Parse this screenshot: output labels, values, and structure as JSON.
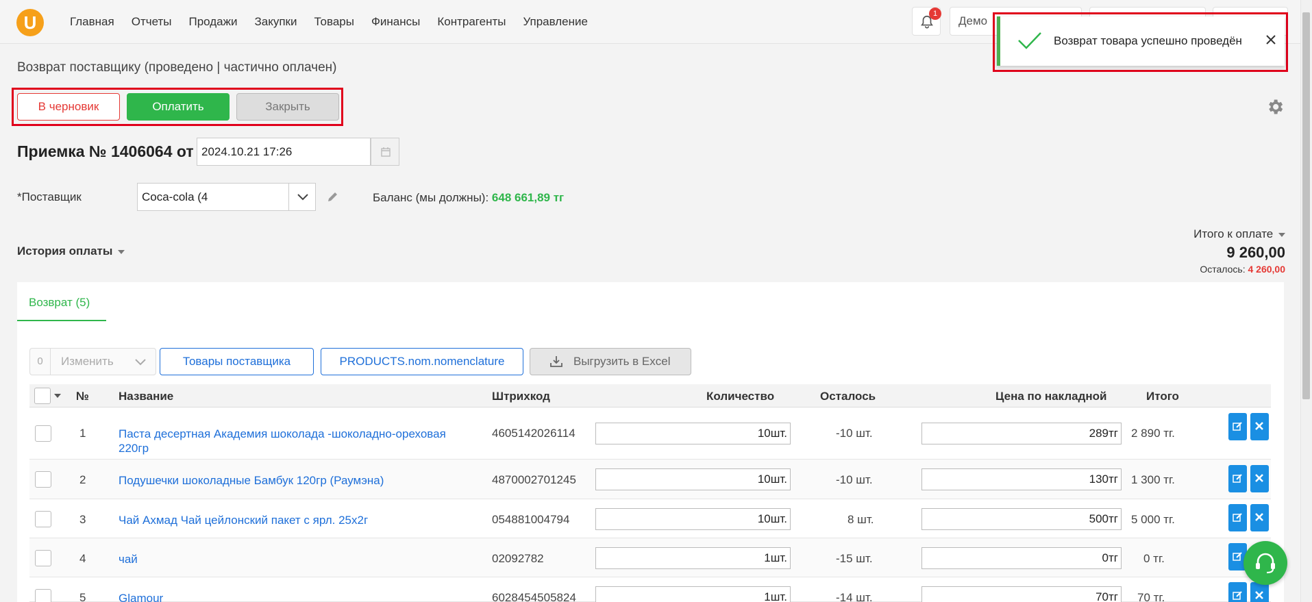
{
  "brand": {
    "logo_letter": "U",
    "accent": "#f6a01a"
  },
  "nav": [
    "Главная",
    "Отчеты",
    "Продажи",
    "Закупки",
    "Товары",
    "Финансы",
    "Контрагенты",
    "Управление"
  ],
  "notifications": {
    "count": "1"
  },
  "org_label": "Демо",
  "toast": {
    "message": "Возврат товара успешно проведён",
    "icon": "check-icon",
    "close_icon": "close-icon"
  },
  "page": {
    "title": "Возврат поставщику (проведено | частично оплачен)"
  },
  "actions": {
    "draft": "В черновик",
    "pay": "Оплатить",
    "close": "Закрыть"
  },
  "receipt": {
    "title": "Приемка № 1406064 от",
    "date": "2024.10.21 17:26"
  },
  "supplier": {
    "label": "*Поставщик",
    "value": "Coca-cola (4",
    "balance_label": "Баланс (мы должны):",
    "balance_value": "648 661,89 тг"
  },
  "payment_history": "История оплаты",
  "totals": {
    "label": "Итого к оплате",
    "value": "9 260,00",
    "remaining_label": "Осталось:",
    "remaining_value": "4 260,00"
  },
  "tab": {
    "label": "Возврат (5)"
  },
  "toolbar": {
    "count": "0",
    "change": "Изменить",
    "supplier_products": "Товары поставщика",
    "nomenclature": "PRODUCTS.nom.nomenclature",
    "excel": "Выгрузить в Excel"
  },
  "table": {
    "columns": {
      "num": "№",
      "name": "Название",
      "barcode": "Штрихкод",
      "qty": "Количество",
      "left": "Осталось",
      "price": "Цена по накладной",
      "total": "Итого"
    },
    "rows": [
      {
        "num": "1",
        "name": "Паста десертная Академия шоколада -шоколадно-ореховая 220гр",
        "barcode": "4605142026114",
        "qty": "10шт.",
        "left": "-10 шт.",
        "price": "289тг",
        "total": "2 890 тг."
      },
      {
        "num": "2",
        "name": "Подушечки шоколадные Бамбук 120гр (Раумэна)",
        "barcode": "4870002701245",
        "qty": "10шт.",
        "left": "-10 шт.",
        "price": "130тг",
        "total": "1 300 тг."
      },
      {
        "num": "3",
        "name": "Чай Ахмад Чай цейлонский пакет с ярл. 25х2г",
        "barcode": "054881004794",
        "qty": "10шт.",
        "left": "8 шт.",
        "price": "500тг",
        "total": "5 000 тг."
      },
      {
        "num": "4",
        "name": "чай",
        "barcode": "02092782",
        "qty": "1шт.",
        "left": "-15 шт.",
        "price": "0тг",
        "total": "0 тг."
      },
      {
        "num": "5",
        "name": "Glamour",
        "barcode": "6028454505824",
        "qty": "1шт.",
        "left": "-14 шт.",
        "price": "70тг",
        "total": "70 тг."
      }
    ]
  }
}
